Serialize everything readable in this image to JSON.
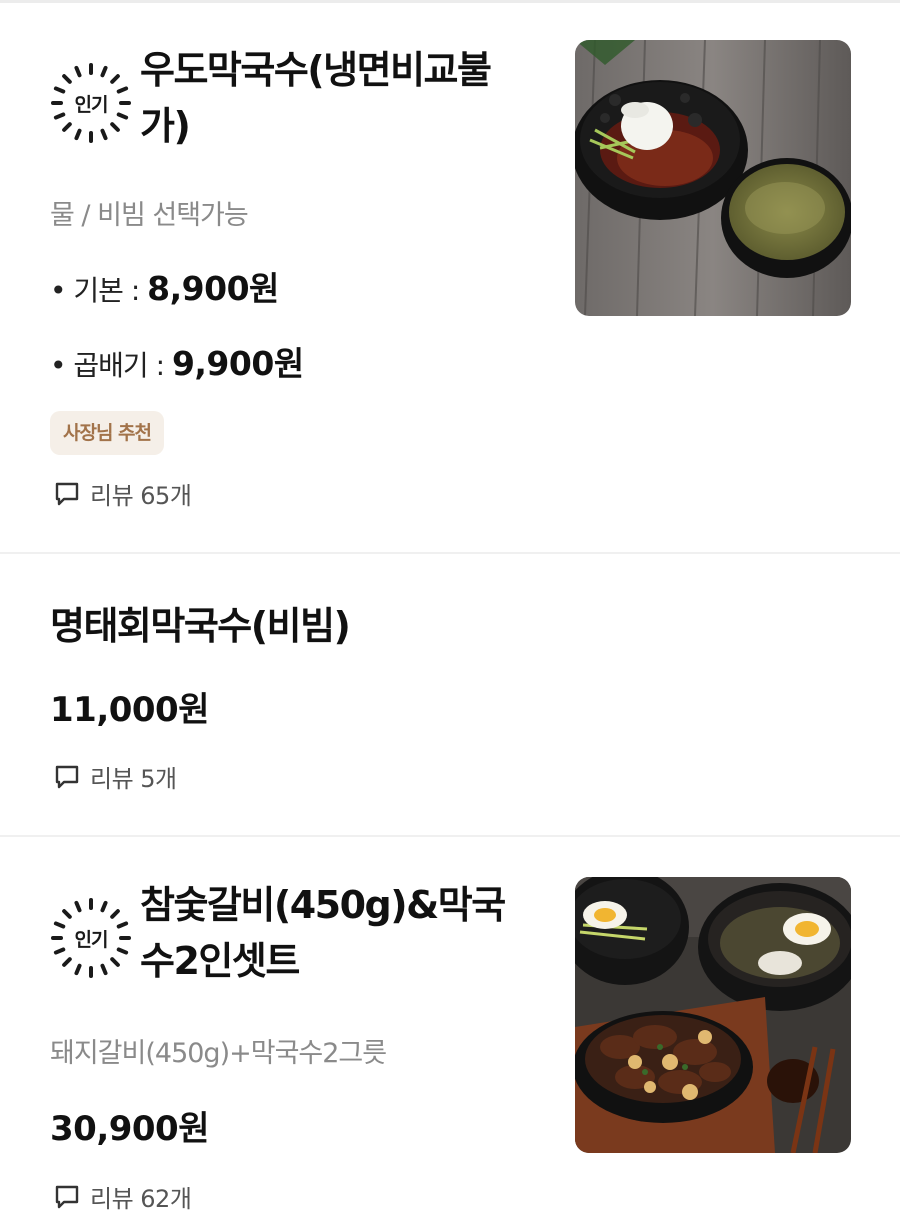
{
  "items": [
    {
      "badge": "인기",
      "title_line1": "우도막국수(냉면비교불",
      "title_line2": "가)",
      "description": "물 / 비빔 선택가능",
      "prices": [
        {
          "label": "• 기본 : ",
          "value": "8,900원"
        },
        {
          "label": "• 곱배기 : ",
          "value": "9,900원"
        }
      ],
      "tag": "사장님 추천",
      "review": "리뷰 65개",
      "image": "bibim-makguksu-photo"
    },
    {
      "title_line1": "명태회막국수(비빔)",
      "price": "11,000원",
      "review": "리뷰 5개"
    },
    {
      "badge": "인기",
      "title_line1": "참숯갈비(450g)&막국",
      "title_line2": "수2인셋트",
      "description": "돼지갈비(450g)+막국수2그릇",
      "price": "30,900원",
      "review": "리뷰 62개",
      "image": "galbi-makguksu-set-photo"
    }
  ],
  "colors": {
    "tag_bg": "#f5efe8",
    "tag_text": "#a2734a",
    "desc_text": "#8a8a8a",
    "divider": "#f0f0f0"
  },
  "icons": {
    "badge_ring": "dashed-sunburst-ring",
    "review": "speech-bubble-icon"
  }
}
